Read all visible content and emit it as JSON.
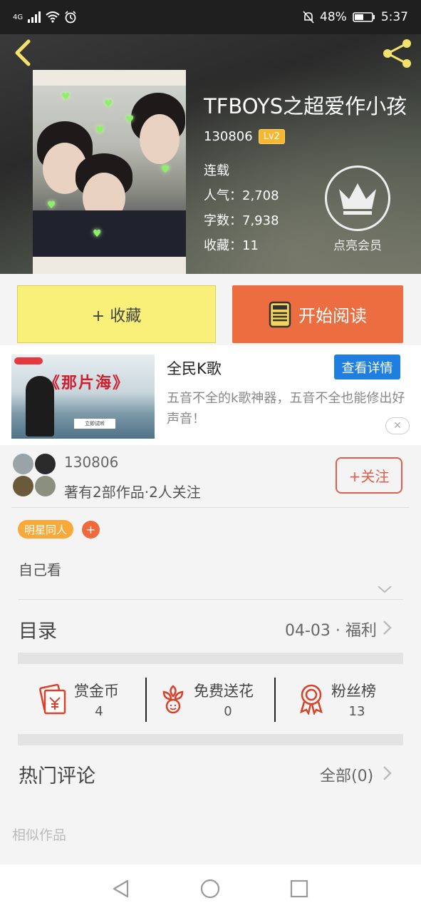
{
  "status_bar": {
    "network": "4G",
    "battery": "48%",
    "time": "5:37"
  },
  "book": {
    "title": "TFBOYS之超爱作小孩",
    "author": "130806",
    "level_badge": "Lv2",
    "status": "连载",
    "popularity": "人气：2,708",
    "word_count": "字数：7,938",
    "favorites": "收藏：11"
  },
  "vip": {
    "label": "点亮会员"
  },
  "actions": {
    "collect_label": "+ 收藏",
    "read_label": "开始阅读"
  },
  "ad": {
    "poster_title": "《那片海》",
    "poster_button": "立即试听",
    "title": "全民K歌",
    "detail_button": "查看详情",
    "description": "五音不全的k歌神器，五音不全也能修出好声音！",
    "close_symbol": "✕"
  },
  "author_section": {
    "name": "130806",
    "info": "著有2部作品·2人关注",
    "follow_button": "+关注"
  },
  "tags": {
    "items": [
      "明星同人"
    ],
    "add_symbol": "+"
  },
  "description": "自己看",
  "toc": {
    "label": "目录",
    "latest": "04-03 · 福利"
  },
  "stats": {
    "reward": {
      "label": "赏金币",
      "value": "4"
    },
    "flowers": {
      "label": "免费送花",
      "value": "0"
    },
    "fans": {
      "label": "粉丝榜",
      "value": "13"
    }
  },
  "comments": {
    "label": "热门评论",
    "all": "全部(0)"
  },
  "similar_label": "相似作品",
  "colors": {
    "accent_orange": "#ec6d40",
    "collect_yellow": "#f9f07a",
    "badge_yellow": "#f7b731",
    "follow_red": "#e25d4a",
    "ad_blue": "#1e7fe0",
    "icon_red": "#d9412b"
  },
  "icons": {
    "back": "chevron-left-icon",
    "share": "share-icon",
    "vip": "crown-icon",
    "read": "book-icon",
    "reward": "red-envelope-icon",
    "flowers": "flower-icon",
    "fans": "medal-icon"
  }
}
